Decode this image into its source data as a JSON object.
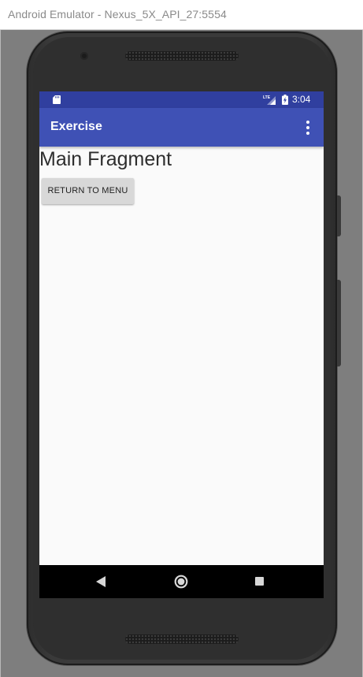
{
  "window": {
    "title": "Android Emulator - Nexus_5X_API_27:5554"
  },
  "status_bar": {
    "time": "3:04",
    "icons": [
      "sd-card-icon",
      "lte-signal-icon",
      "battery-charging-icon"
    ],
    "color": "#303f9f"
  },
  "app_bar": {
    "title": "Exercise",
    "overflow_icon": "more-vert-icon",
    "color": "#3f51b5"
  },
  "content": {
    "fragment_title": "Main Fragment",
    "return_button_label": "RETURN TO MENU"
  },
  "nav_bar": {
    "icons": [
      "back-icon",
      "home-icon",
      "recents-icon"
    ]
  }
}
